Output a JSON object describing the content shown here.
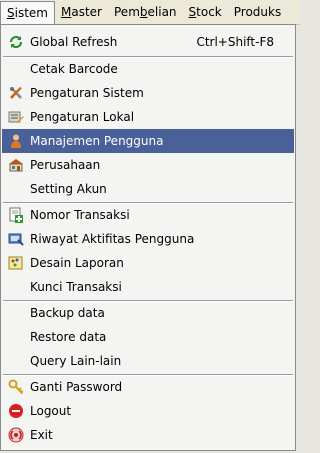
{
  "menubar": {
    "items": [
      {
        "pre": "",
        "ul": "S",
        "post": "istem"
      },
      {
        "pre": "",
        "ul": "M",
        "post": "aster"
      },
      {
        "pre": "Pem",
        "ul": "b",
        "post": "elian"
      },
      {
        "pre": "",
        "ul": "S",
        "post": "tock"
      },
      {
        "pre": "Produks",
        "ul": "",
        "post": ""
      }
    ]
  },
  "menu": {
    "global_refresh": {
      "label": "Global Refresh",
      "shortcut": "Ctrl+Shift-F8",
      "icon": "refresh-icon"
    },
    "cetak_barcode": {
      "label": "Cetak Barcode"
    },
    "pengaturan_sistem": {
      "label": "Pengaturan Sistem",
      "icon": "tools-icon"
    },
    "pengaturan_lokal": {
      "label": "Pengaturan Lokal",
      "icon": "settings-pencil-icon"
    },
    "manajemen_pengguna": {
      "label": "Manajemen Pengguna",
      "icon": "user-icon"
    },
    "perusahaan": {
      "label": "Perusahaan",
      "icon": "company-icon"
    },
    "setting_akun": {
      "label": "Setting Akun"
    },
    "nomor_transaksi": {
      "label": "Nomor Transaksi",
      "icon": "document-add-icon"
    },
    "riwayat_aktifitas": {
      "label": "Riwayat Aktifitas Pengguna",
      "icon": "history-icon"
    },
    "desain_laporan": {
      "label": "Desain Laporan",
      "icon": "report-design-icon"
    },
    "kunci_transaksi": {
      "label": "Kunci Transaksi"
    },
    "backup_data": {
      "label": "Backup data"
    },
    "restore_data": {
      "label": "Restore data"
    },
    "query_lain": {
      "label": "Query Lain-lain"
    },
    "ganti_password": {
      "label": "Ganti Password",
      "icon": "key-icon"
    },
    "logout": {
      "label": "Logout",
      "icon": "logout-icon"
    },
    "exit": {
      "label": "Exit",
      "icon": "exit-icon"
    }
  },
  "colors": {
    "highlight": "#4a6098",
    "menubar_bg": "#ece9d8",
    "menu_bg": "#f4f4f2"
  }
}
